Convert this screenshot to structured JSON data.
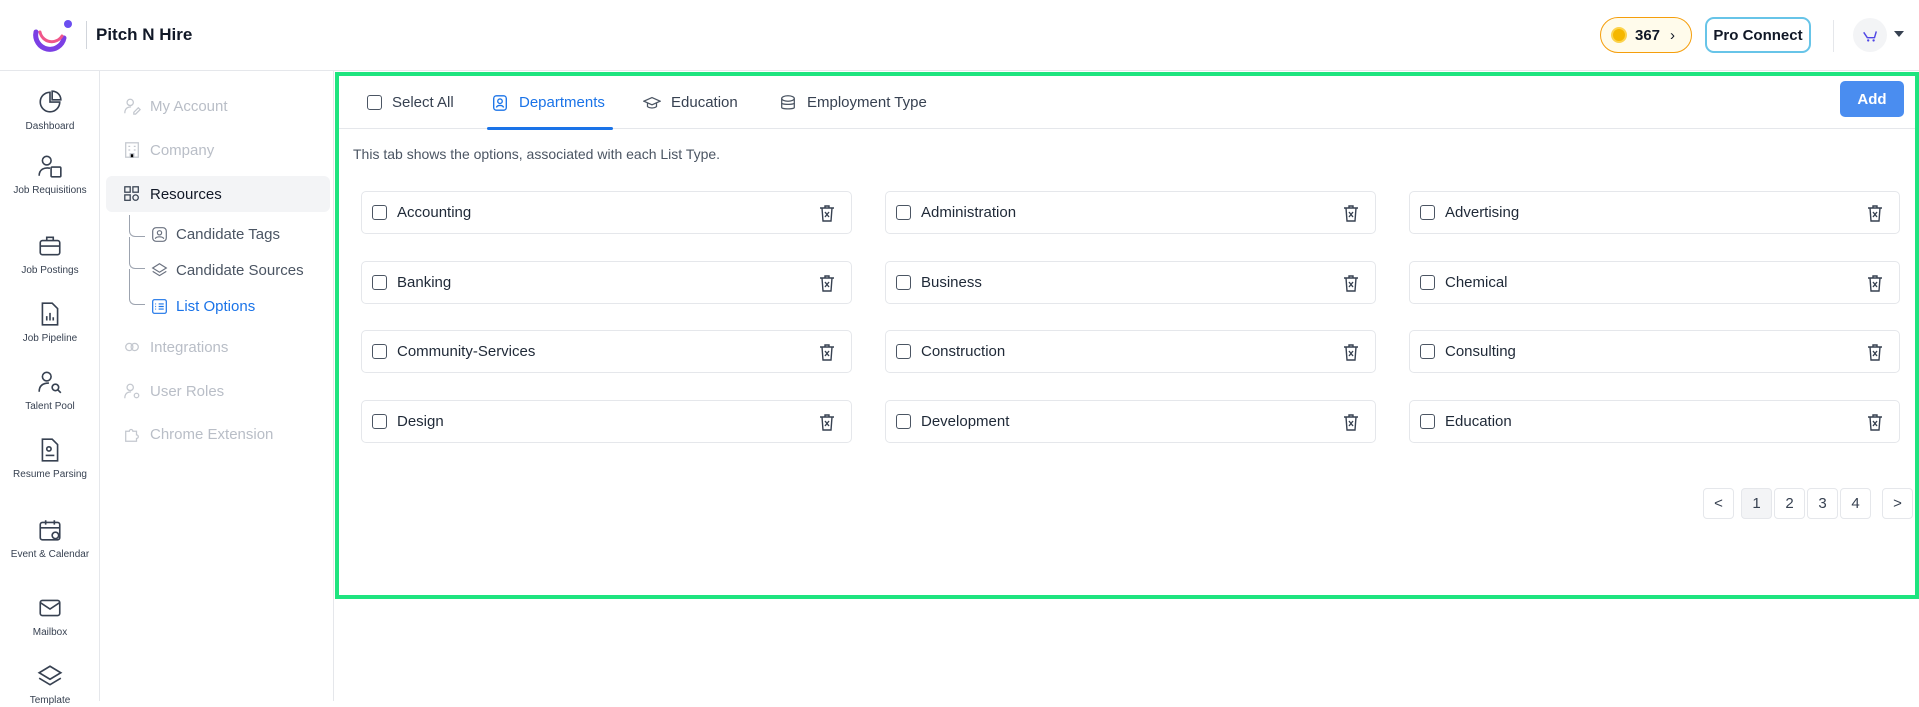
{
  "header": {
    "brand": "Pitch N Hire",
    "coins": "367",
    "pro_connect": "Pro Connect"
  },
  "rail": {
    "items": [
      {
        "label": "Dashboard",
        "icon": "pie-chart-icon"
      },
      {
        "label": "Job Requisitions",
        "icon": "user-document-icon"
      },
      {
        "label": "Job Postings",
        "icon": "briefcase-icon"
      },
      {
        "label": "Job Pipeline",
        "icon": "file-chart-icon"
      },
      {
        "label": "Talent Pool",
        "icon": "user-search-icon"
      },
      {
        "label": "Resume Parsing",
        "icon": "resume-icon"
      },
      {
        "label": "Event & Calendar",
        "icon": "calendar-icon"
      },
      {
        "label": "Mailbox",
        "icon": "mail-icon"
      },
      {
        "label": "Template",
        "icon": "layers-icon"
      }
    ]
  },
  "sidebar": {
    "items": [
      {
        "label": "My Account",
        "state": "disabled"
      },
      {
        "label": "Company",
        "state": "disabled"
      },
      {
        "label": "Resources",
        "state": "active"
      },
      {
        "label": "Integrations",
        "state": "disabled"
      },
      {
        "label": "User Roles",
        "state": "disabled"
      },
      {
        "label": "Chrome Extension",
        "state": "disabled"
      }
    ],
    "resources_children": [
      {
        "label": "Candidate Tags",
        "active": false
      },
      {
        "label": "Candidate Sources",
        "active": false
      },
      {
        "label": "List Options",
        "active": true
      }
    ]
  },
  "main": {
    "select_all": "Select All",
    "tabs": [
      {
        "label": "Departments",
        "active": true
      },
      {
        "label": "Education",
        "active": false
      },
      {
        "label": "Employment Type",
        "active": false
      }
    ],
    "add_label": "Add",
    "info_text": "This tab shows the options, associated with each List Type.",
    "options": [
      "Accounting",
      "Administration",
      "Advertising",
      "Banking",
      "Business",
      "Chemical",
      "Community-Services",
      "Construction",
      "Consulting",
      "Design",
      "Development",
      "Education"
    ],
    "pagination": {
      "prev": "<",
      "pages": [
        "1",
        "2",
        "3",
        "4"
      ],
      "current": "1",
      "next": ">"
    }
  },
  "colors": {
    "accent": "#1a73e8",
    "add_button": "#4a8df0",
    "panel_outline": "#1ee47f",
    "coins_border": "#f59e0b"
  }
}
